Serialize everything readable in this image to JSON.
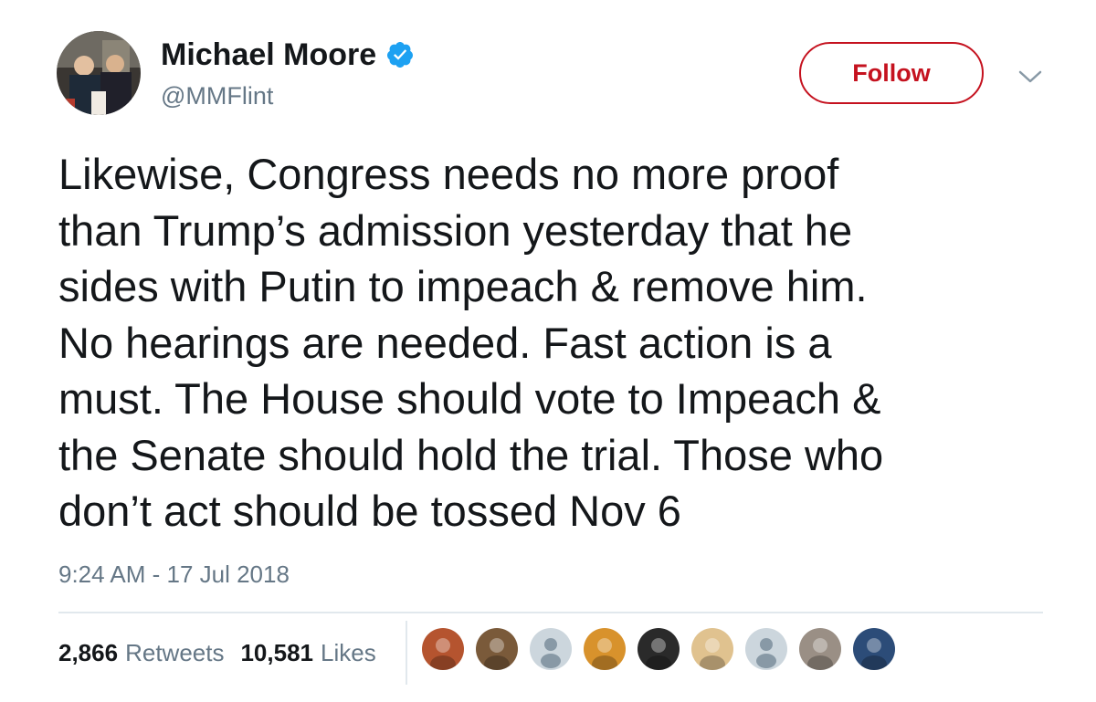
{
  "author": {
    "name": "Michael Moore",
    "handle": "@MMFlint",
    "verified": true,
    "verified_icon": "verified-badge-icon"
  },
  "follow_button": {
    "label": "Follow"
  },
  "tweet": {
    "text": "Likewise, Congress needs no more proof\nthan Trump’s admission yesterday that he\nsides with Putin to impeach & remove him.\nNo hearings are needed. Fast action is a\nmust. The House should vote to Impeach &\nthe Senate should hold the trial. Those who\ndon’t act should be tossed Nov 6",
    "timestamp": "9:24 AM - 17 Jul 2018"
  },
  "stats": {
    "retweets_count": "2,866",
    "retweets_label": "Retweets",
    "likes_count": "10,581",
    "likes_label": "Likes"
  },
  "liker_avatars": [
    {
      "kind": "photo",
      "color": "#b5542f"
    },
    {
      "kind": "photo",
      "color": "#7a5a3a"
    },
    {
      "kind": "default",
      "color": "#ccd6dd"
    },
    {
      "kind": "photo",
      "color": "#d8922c"
    },
    {
      "kind": "photo",
      "color": "#2a2a2a"
    },
    {
      "kind": "photo",
      "color": "#e0c28f"
    },
    {
      "kind": "default",
      "color": "#ccd6dd"
    },
    {
      "kind": "photo",
      "color": "#9a8f85"
    },
    {
      "kind": "photo",
      "color": "#2c4c78"
    }
  ],
  "colors": {
    "accent": "#c5121f",
    "verified": "#1da1f2",
    "secondary_text": "#657786",
    "primary_text": "#14171a"
  }
}
